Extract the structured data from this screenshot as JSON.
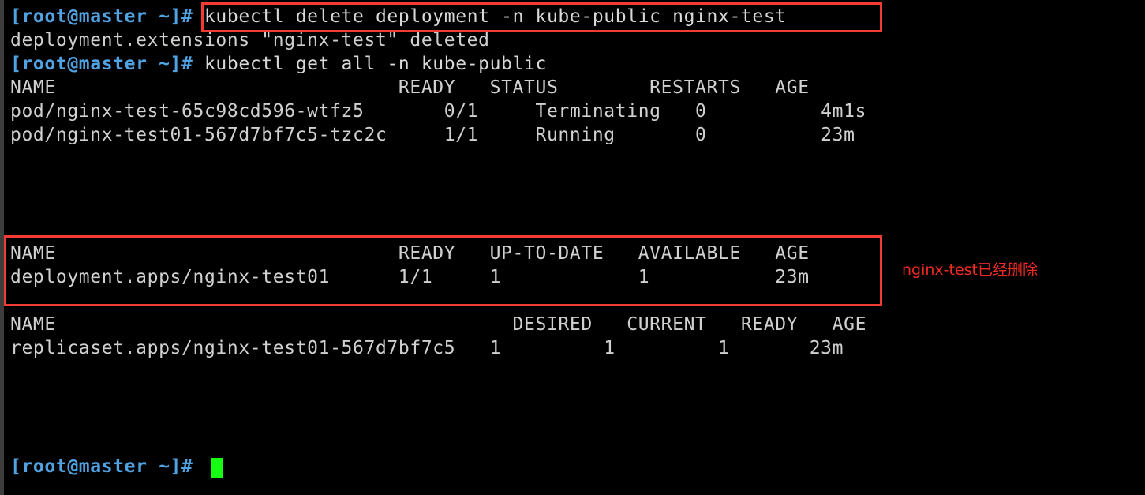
{
  "terminal": {
    "prompt": "[root@master ~]#",
    "lines": [
      {
        "id": "line-1",
        "kind": "command",
        "prompt": "[root@master ~]#",
        "text": " kubectl delete deployment -n kube-public nginx-test"
      },
      {
        "id": "line-2",
        "kind": "output",
        "text": "deployment.extensions \"nginx-test\" deleted"
      },
      {
        "id": "line-3",
        "kind": "command",
        "prompt": "[root@master ~]#",
        "text": " kubectl get all -n kube-public"
      },
      {
        "id": "line-4",
        "kind": "output",
        "text": "NAME                              READY   STATUS        RESTARTS   AGE"
      },
      {
        "id": "line-5",
        "kind": "output",
        "text": "pod/nginx-test-65c98cd596-wtfz5       0/1     Terminating   0          4m1s"
      },
      {
        "id": "line-6",
        "kind": "output",
        "text": "pod/nginx-test01-567d7bf7c5-tzc2c     1/1     Running       0          23m"
      },
      {
        "id": "line-7",
        "kind": "output",
        "text": "NAME                              READY   UP-TO-DATE   AVAILABLE   AGE"
      },
      {
        "id": "line-8",
        "kind": "output",
        "text": "deployment.apps/nginx-test01      1/1     1            1           23m"
      },
      {
        "id": "line-9",
        "kind": "output",
        "text": "NAME                                        DESIRED   CURRENT   READY   AGE"
      },
      {
        "id": "line-10",
        "kind": "output",
        "text": "replicaset.apps/nginx-test01-567d7bf7c5   1         1         1       23m"
      },
      {
        "id": "line-11",
        "kind": "command",
        "prompt": "[root@master ~]#",
        "text": " "
      }
    ],
    "commands": {
      "delete_deployment": "kubectl delete deployment -n kube-public nginx-test",
      "get_all": "kubectl get all -n kube-public"
    },
    "pods_table": {
      "headers": [
        "NAME",
        "READY",
        "STATUS",
        "RESTARTS",
        "AGE"
      ],
      "rows": [
        [
          "pod/nginx-test-65c98cd596-wtfz5",
          "0/1",
          "Terminating",
          "0",
          "4m1s"
        ],
        [
          "pod/nginx-test01-567d7bf7c5-tzc2c",
          "1/1",
          "Running",
          "0",
          "23m"
        ]
      ]
    },
    "deployments_table": {
      "headers": [
        "NAME",
        "READY",
        "UP-TO-DATE",
        "AVAILABLE",
        "AGE"
      ],
      "rows": [
        [
          "deployment.apps/nginx-test01",
          "1/1",
          "1",
          "1",
          "23m"
        ]
      ]
    },
    "replicasets_table": {
      "headers": [
        "NAME",
        "DESIRED",
        "CURRENT",
        "READY",
        "AGE"
      ],
      "rows": [
        [
          "replicaset.apps/nginx-test01-567d7bf7c5",
          "1",
          "1",
          "1",
          "23m"
        ]
      ]
    },
    "deleted_message": "deployment.extensions \"nginx-test\" deleted"
  },
  "annotations": {
    "note_text": "nginx-test已经删除",
    "box_color": "#f23b32",
    "note_color": "#ef2a25"
  },
  "colors": {
    "background": "#000000",
    "prompt_blue": "#4fa3e3",
    "text": "#d8d8d8",
    "cursor_green": "#15ff15",
    "window_edge": "#3d3d3d"
  }
}
